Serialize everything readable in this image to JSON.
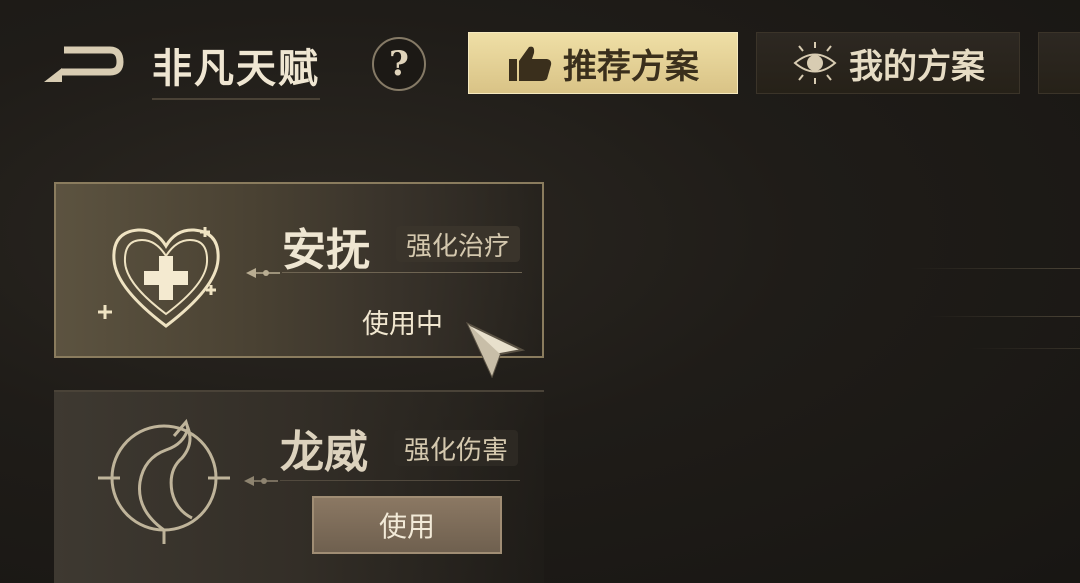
{
  "header": {
    "title": "非凡天赋",
    "help_symbol": "?",
    "back_icon": "back-arrow-icon"
  },
  "tabs": [
    {
      "label": "推荐方案",
      "icon": "thumbs-up-icon",
      "selected": true
    },
    {
      "label": "我的方案",
      "icon": "eye-emblem-icon",
      "selected": false
    },
    {
      "label": "",
      "icon": "partial-tab",
      "selected": false
    }
  ],
  "cards": [
    {
      "name": "安抚",
      "tag": "强化治疗",
      "status": "使用中",
      "emblem": "heart-cross-icon",
      "active": true
    },
    {
      "name": "龙威",
      "tag": "强化伤害",
      "button_label": "使用",
      "emblem": "dragon-icon",
      "active": false
    }
  ],
  "colors": {
    "accent_gold": "#e4d196",
    "background": "#1f1c18",
    "text_primary": "#efe6d2"
  }
}
